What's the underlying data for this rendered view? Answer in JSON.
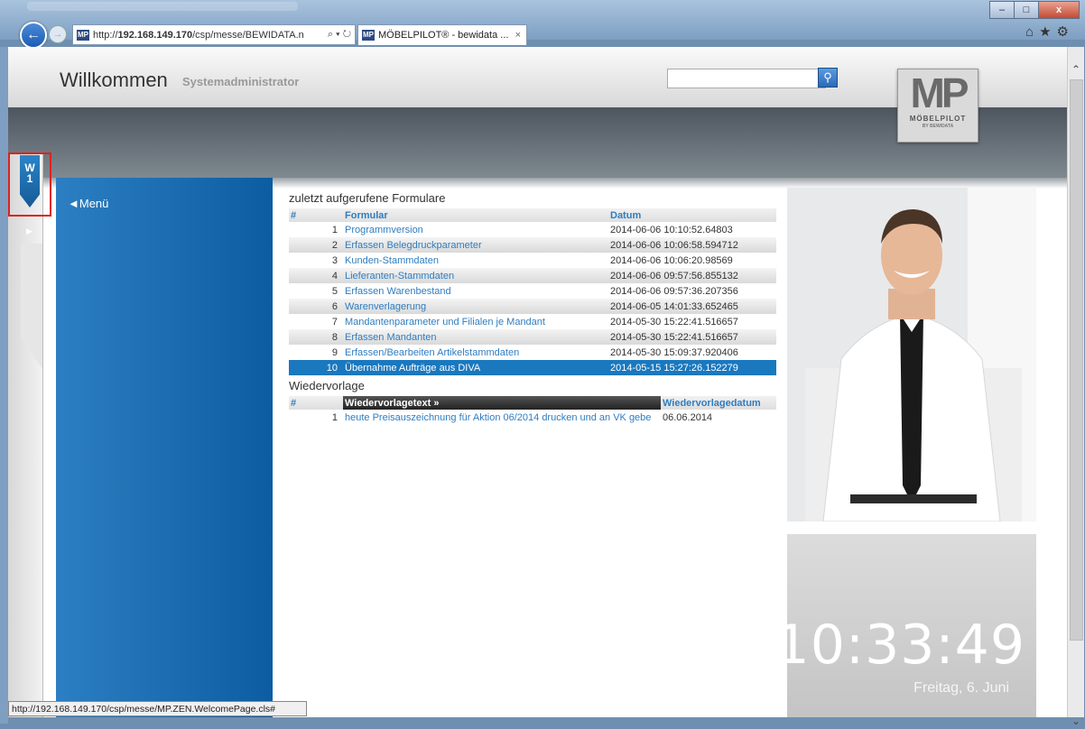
{
  "browser": {
    "address_prefix": "http://",
    "address_host": "192.168.149.170",
    "address_path": "/csp/messe/BEWIDATA.n",
    "address_tools": "⌕ ▾ ↻",
    "tab_title": "MÖBELPILOT® - bewidata ...",
    "tab_close": "×",
    "status_url": "http://192.168.149.170/csp/messe/MP.ZEN.WelcomePage.cls#",
    "window_buttons": [
      "–",
      "□",
      "x"
    ],
    "favicon_text": "MP",
    "toolbar_icons": "⌂★⚙"
  },
  "header": {
    "welcome": "Willkommen",
    "role": "Systemadministrator",
    "search_placeholder": "",
    "logo_big": "MP",
    "logo_name": "MÖBELPILOT",
    "logo_sub": "BY BEWIDATA"
  },
  "rail": {
    "tab_line1": "W",
    "tab_line2": "1"
  },
  "sidebar": {
    "menu_label": "Menü",
    "menu_arrow": "◄"
  },
  "recent": {
    "title": "zuletzt aufgerufene Formulare",
    "headers": [
      "#",
      "Formular",
      "Datum"
    ],
    "rows": [
      [
        "1",
        "Programmversion",
        "2014-06-06 10:10:52.64803"
      ],
      [
        "2",
        "Erfassen Belegdruckparameter",
        "2014-06-06 10:06:58.594712"
      ],
      [
        "3",
        "Kunden-Stammdaten",
        "2014-06-06 10:06:20.98569"
      ],
      [
        "4",
        "Lieferanten-Stammdaten",
        "2014-06-06 09:57:56.855132"
      ],
      [
        "5",
        "Erfassen Warenbestand",
        "2014-06-06 09:57:36.207356"
      ],
      [
        "6",
        "Warenverlagerung",
        "2014-06-05 14:01:33.652465"
      ],
      [
        "7",
        "Mandantenparameter und Filialen je Mandant",
        "2014-05-30 15:22:41.516657"
      ],
      [
        "8",
        "Erfassen Mandanten",
        "2014-05-30 15:22:41.516657"
      ],
      [
        "9",
        "Erfassen/Bearbeiten Artikelstammdaten",
        "2014-05-30 15:09:37.920406"
      ],
      [
        "10",
        "Übernahme Aufträge aus DIVA",
        "2014-05-15 15:27:26.152279"
      ]
    ],
    "selected_index": 9
  },
  "resubmission": {
    "title": "Wiedervorlage",
    "headers": [
      "#",
      "Wiedervorlagetext »",
      "Wiedervorlagedatum"
    ],
    "rows": [
      [
        "1",
        "heute Preisauszeichnung für Aktion 06/2014 drucken und an VK gebe",
        "06.06.2014"
      ]
    ]
  },
  "clock": {
    "time": "10:33:49",
    "date": "Freitag, 6. Juni"
  }
}
